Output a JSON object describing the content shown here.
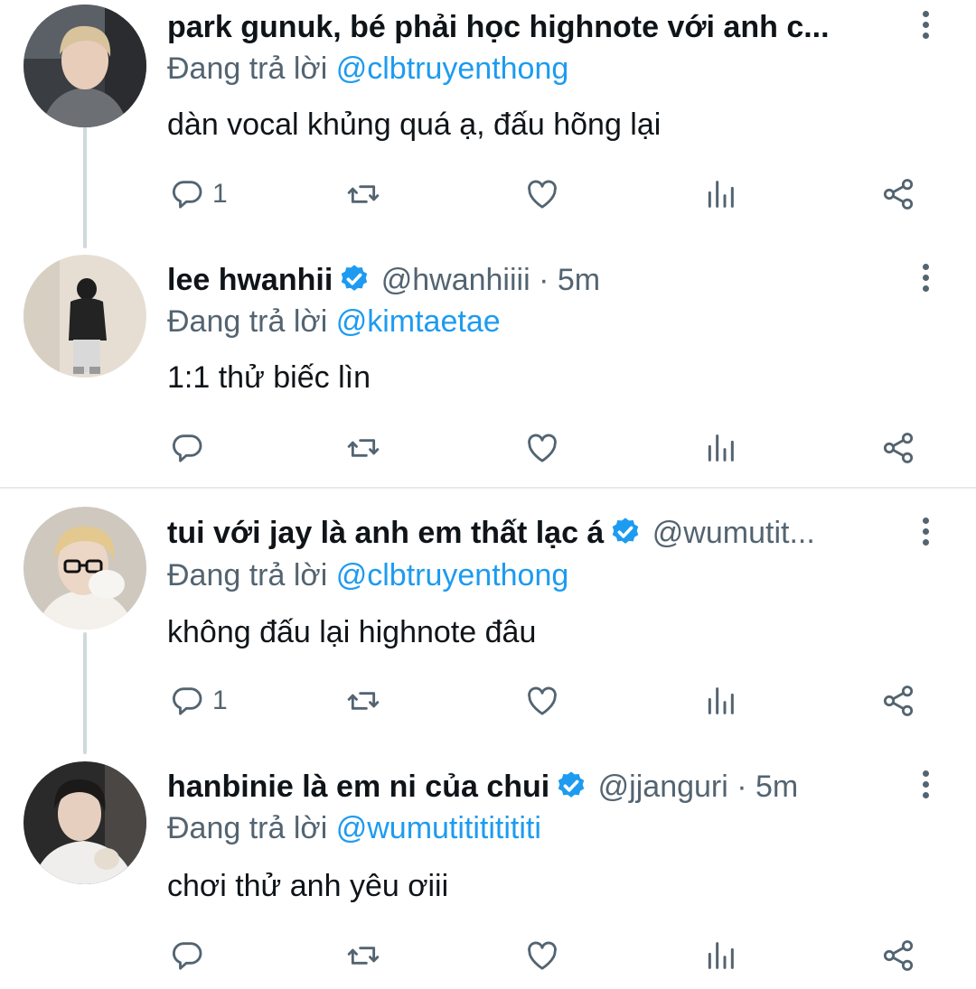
{
  "reply_prefix": "Đang trả lời",
  "tweets": [
    {
      "name": "park gunuk, bé phải học highnote với anh c...",
      "verified": false,
      "handle": "",
      "time": "",
      "replying_to": "@clbtruyenthong",
      "text": "dàn vocal khủng quá ạ, đấu hõng lại",
      "reply_count": "1"
    },
    {
      "name": "lee hwanhii",
      "verified": true,
      "handle": "@hwanhiiii",
      "time": " · 5m",
      "replying_to": "@kimtaetae",
      "text": "1:1 thử biếc lìn",
      "reply_count": ""
    },
    {
      "name": "tui với jay là anh em thất lạc á",
      "verified": true,
      "handle": "@wumutit...",
      "time": "",
      "replying_to": "@clbtruyenthong",
      "text": "không đấu lại highnote đâu",
      "reply_count": "1"
    },
    {
      "name": "hanbinie là em ni của chui",
      "verified": true,
      "handle": "@jjanguri",
      "time": " · 5m",
      "replying_to": "@wumutitititititi",
      "text": "chơi thử anh yêu ơiii",
      "reply_count": ""
    }
  ],
  "colors": {
    "accent": "#1d9bf0",
    "secondary_text": "#536471",
    "primary_text": "#0f1419",
    "thread_line": "#cfd9de"
  },
  "icons": [
    "reply-icon",
    "retweet-icon",
    "like-icon",
    "views-icon",
    "share-icon",
    "more-options-icon",
    "verified-badge-icon"
  ]
}
